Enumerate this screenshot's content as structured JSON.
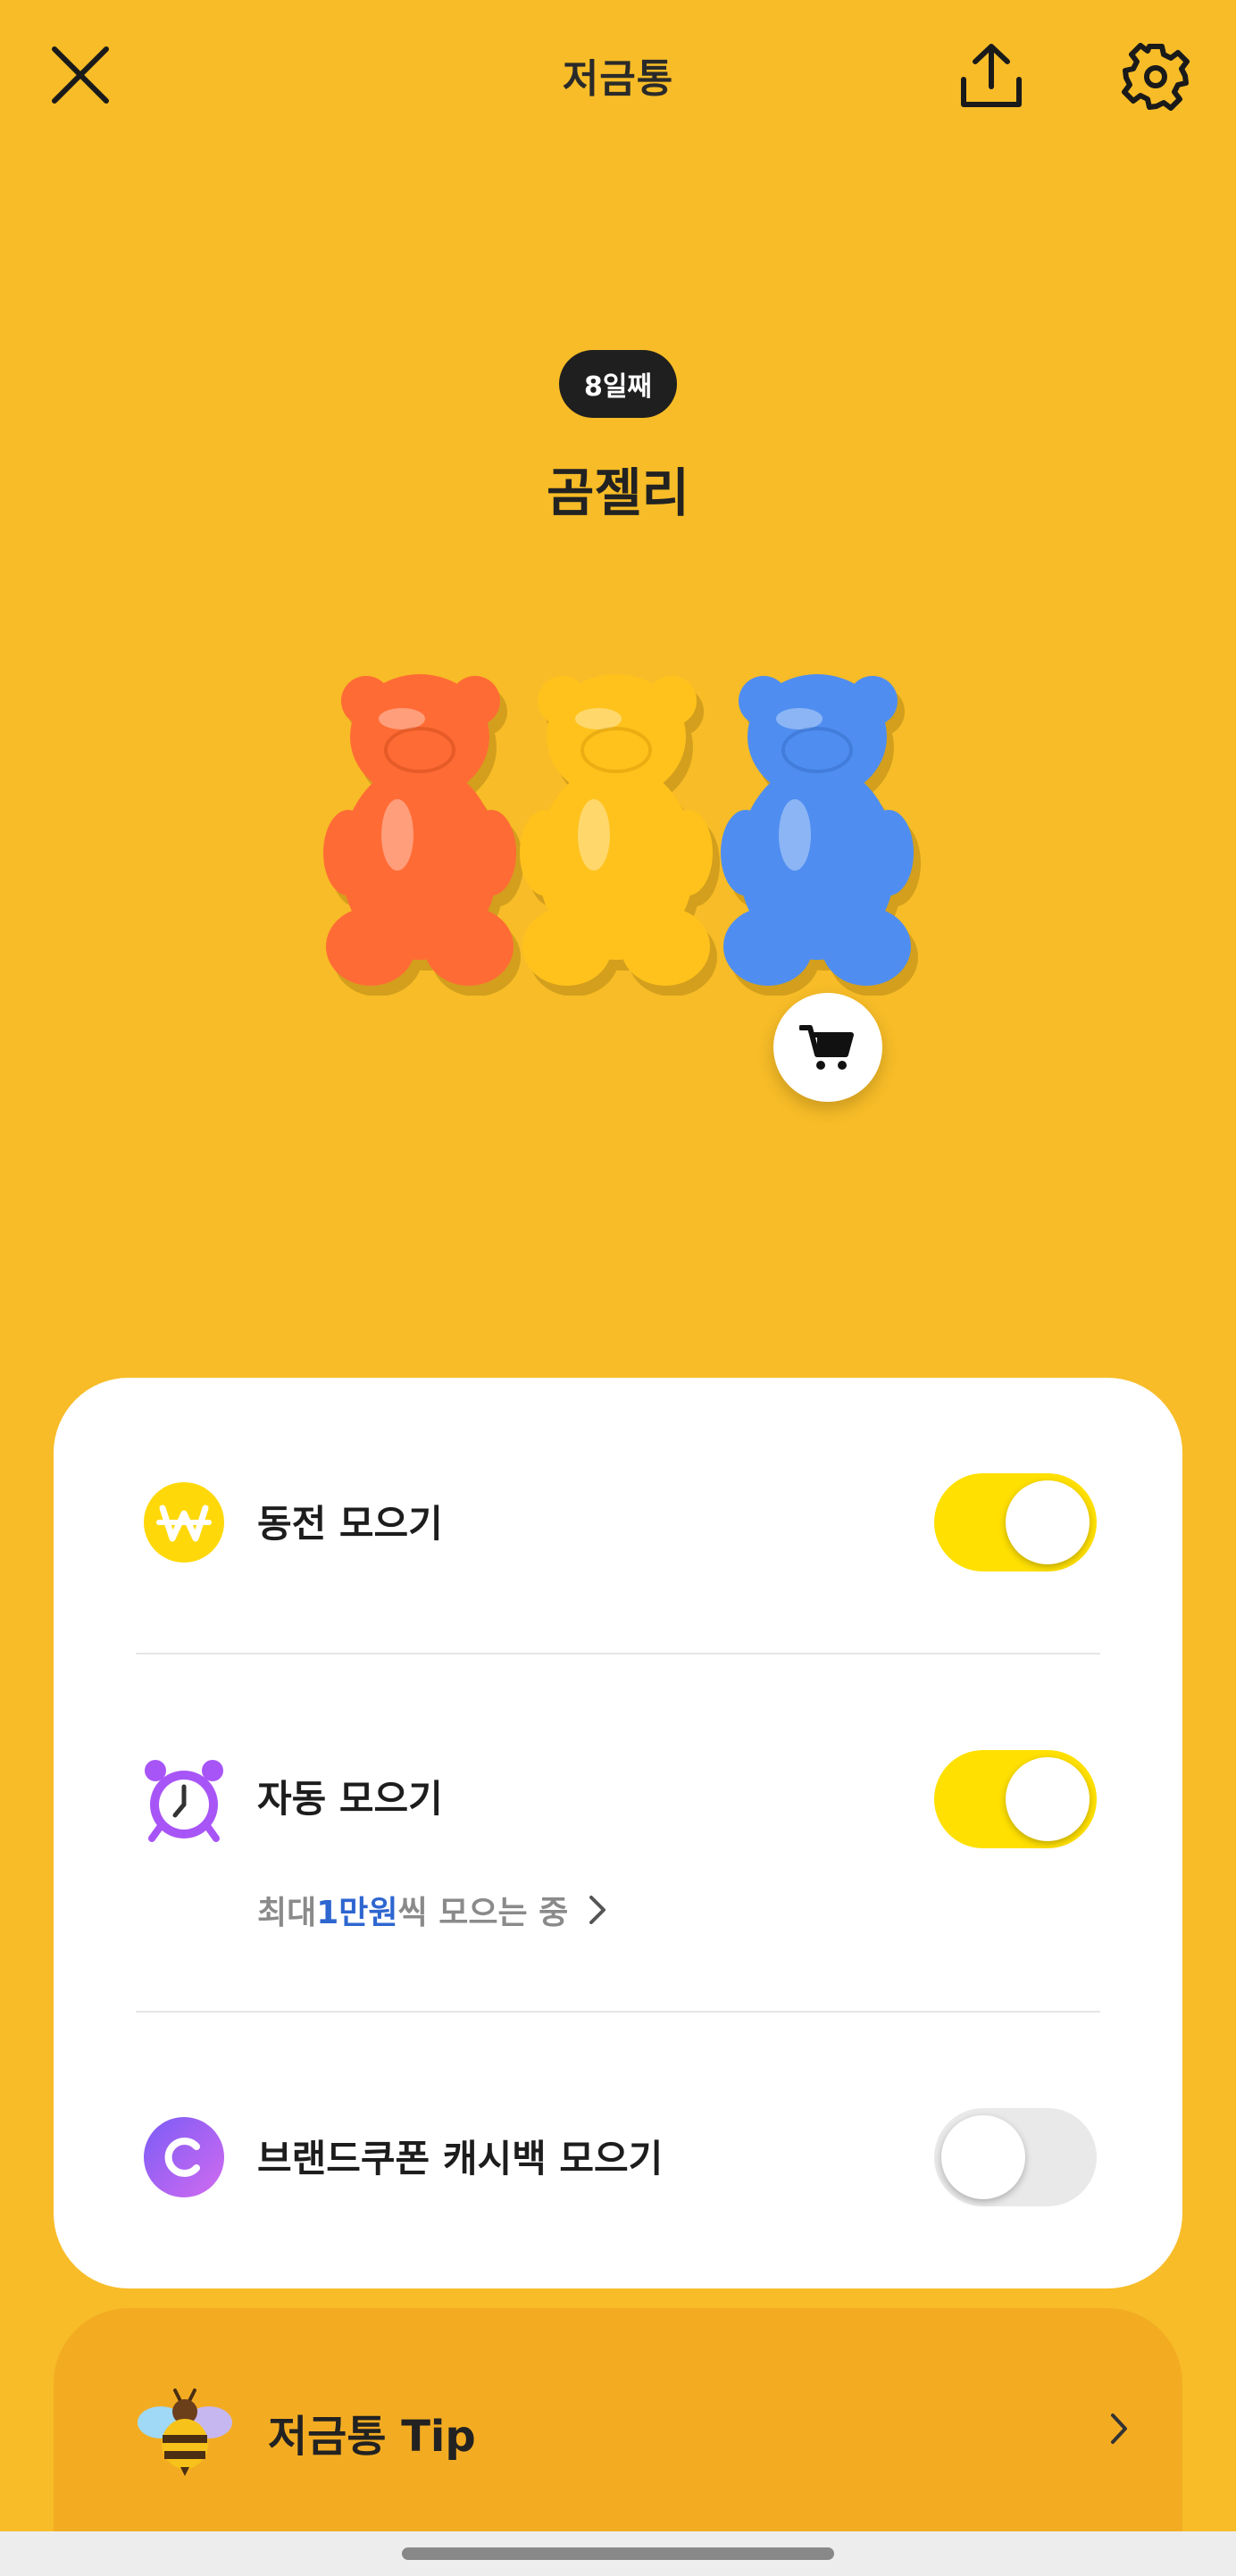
{
  "header": {
    "title": "저금통"
  },
  "hero": {
    "day_badge": "8일째",
    "item_name": "곰젤리"
  },
  "savings_options": [
    {
      "label": "동전 모으기",
      "icon": "won-coin-icon",
      "enabled": true
    },
    {
      "label": "자동 모으기",
      "icon": "alarm-clock-icon",
      "enabled": true,
      "sub_prefix": "최대 ",
      "sub_amount": "1만원",
      "sub_suffix": "씩 모으는 중"
    },
    {
      "label": "브랜드쿠폰 캐시백 모으기",
      "icon": "cashback-c-icon",
      "enabled": false
    }
  ],
  "tip": {
    "label": "저금통 Tip",
    "icon": "bee-icon"
  },
  "colors": {
    "background": "#F7BC27",
    "toggle_on": "#FFE000",
    "toggle_off": "#E9E9E9",
    "amount_accent": "#2E66D0",
    "tip_card": "#F3AC22"
  }
}
